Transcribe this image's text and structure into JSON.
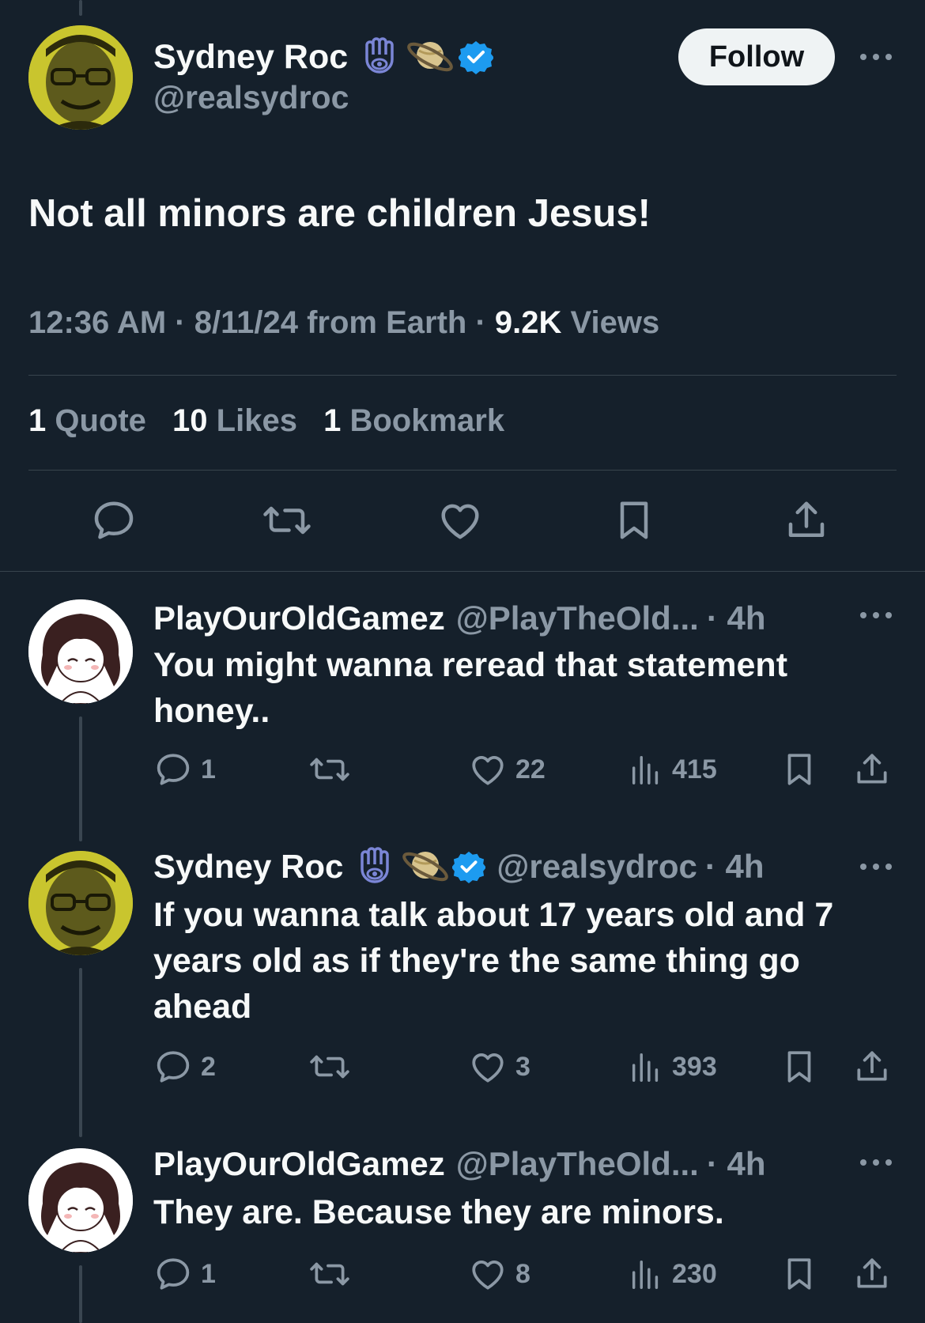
{
  "main_tweet": {
    "author_name": "Sydney Roc",
    "author_handle": "@realsydroc",
    "follow_label": "Follow",
    "text": "Not all minors are children Jesus!",
    "time": "12:36 AM",
    "sep1": "·",
    "date_source": "8/11/24 from Earth",
    "sep2": "·",
    "views_count": "9.2K",
    "views_label": "Views",
    "quote_count": "1",
    "quote_label": "Quote",
    "likes_count": "10",
    "likes_label": "Likes",
    "bookmark_count": "1",
    "bookmark_label": "Bookmark"
  },
  "replies": [
    {
      "name": "PlayOurOldGamez",
      "handle": "@PlayTheOld...",
      "time": "· 4h",
      "text": "You might wanna reread that statement honey..",
      "replies": "1",
      "retweets": "",
      "likes": "22",
      "views": "415"
    },
    {
      "name": "Sydney Roc",
      "handle": "@realsydroc",
      "time": "· 4h",
      "text": "If you wanna talk about 17 years old and 7 years old as if they're the same thing go ahead",
      "replies": "2",
      "retweets": "",
      "likes": "3",
      "views": "393"
    },
    {
      "name": "PlayOurOldGamez",
      "handle": "@PlayTheOld...",
      "time": "· 4h",
      "text": "They are. Because they are minors.",
      "replies": "1",
      "retweets": "",
      "likes": "8",
      "views": "230"
    }
  ],
  "icons": {
    "hamsa": "hamsa-icon",
    "planet": "ringed-planet-icon",
    "verified": "verified-badge-icon",
    "more": "more-icon"
  },
  "colors": {
    "background": "#15202b",
    "text": "#f7f9f9",
    "muted": "#8b98a5",
    "verified": "#1d9bf0",
    "divider": "#38444d"
  }
}
